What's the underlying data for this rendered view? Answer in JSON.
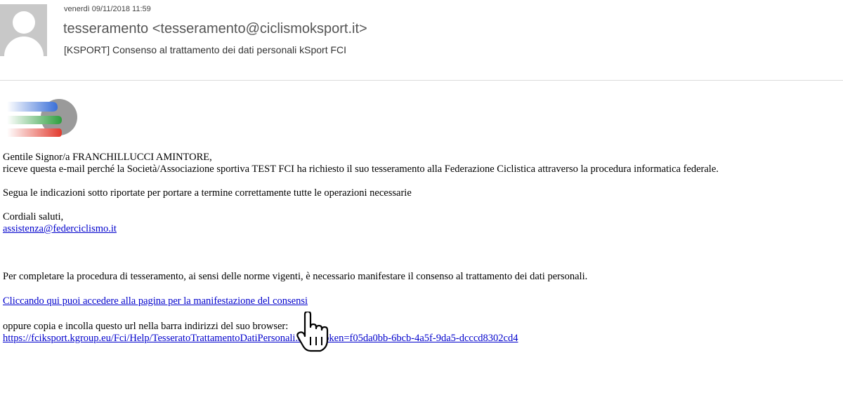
{
  "header": {
    "date": "venerdì 09/11/2018 11:59",
    "sender": "tesseramento <tesseramento@ciclismoksport.it>",
    "subject": "[KSPORT] Consenso al trattamento dei dati personali kSport FCI"
  },
  "body": {
    "greeting": "Gentile Signor/a FRANCHILLUCCI AMINTORE,",
    "intro": "riceve questa e-mail perché la Società/Associazione sportiva TEST FCI ha richiesto il suo tesseramento alla Federazione Ciclistica attraverso la procedura informatica federale.",
    "instructions": "Segua le indicazioni sotto riportate per portare a termine correttamente tutte le operazioni necessarie",
    "closing": "Cordiali saluti,",
    "support_email": "assistenza@federciclismo.it",
    "consent_text": "Per completare la procedura di tesseramento, ai sensi delle norme vigenti, è necessario manifestare il consenso al trattamento dei dati personali.",
    "consent_link": "Cliccando qui puoi accedere alla pagina per la manifestazione del consensi",
    "copy_text": "oppure copia e incolla questo url nella barra indirizzi del suo browser:",
    "url": "https://fciksport.kgroup.eu/Fci/Help/TesseratoTrattamentoDatiPersonali.aspx?token=f05da0bb-6bcb-4a5f-9da5-dcccd8302cd4"
  },
  "colors": {
    "link": "#0000cc",
    "logo_blue": "#3a6fd8",
    "logo_green": "#2e9e3e",
    "logo_red": "#e23a2e",
    "logo_grey": "#9a9a9a"
  },
  "icons": {
    "avatar": "person-silhouette-icon",
    "cursor": "hand-pointer-icon"
  }
}
